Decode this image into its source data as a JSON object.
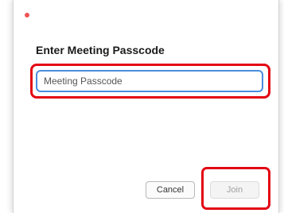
{
  "dialog": {
    "title": "Enter Meeting Passcode",
    "passcode": {
      "placeholder": "Meeting Passcode",
      "value": ""
    },
    "buttons": {
      "cancel_label": "Cancel",
      "join_label": "Join"
    }
  },
  "colors": {
    "highlight": "#e30613",
    "focus_ring": "#4a8de0",
    "close_dot": "#ee5555",
    "join_disabled_text": "#a0a0a0"
  },
  "icons": {
    "close": "close-icon"
  }
}
